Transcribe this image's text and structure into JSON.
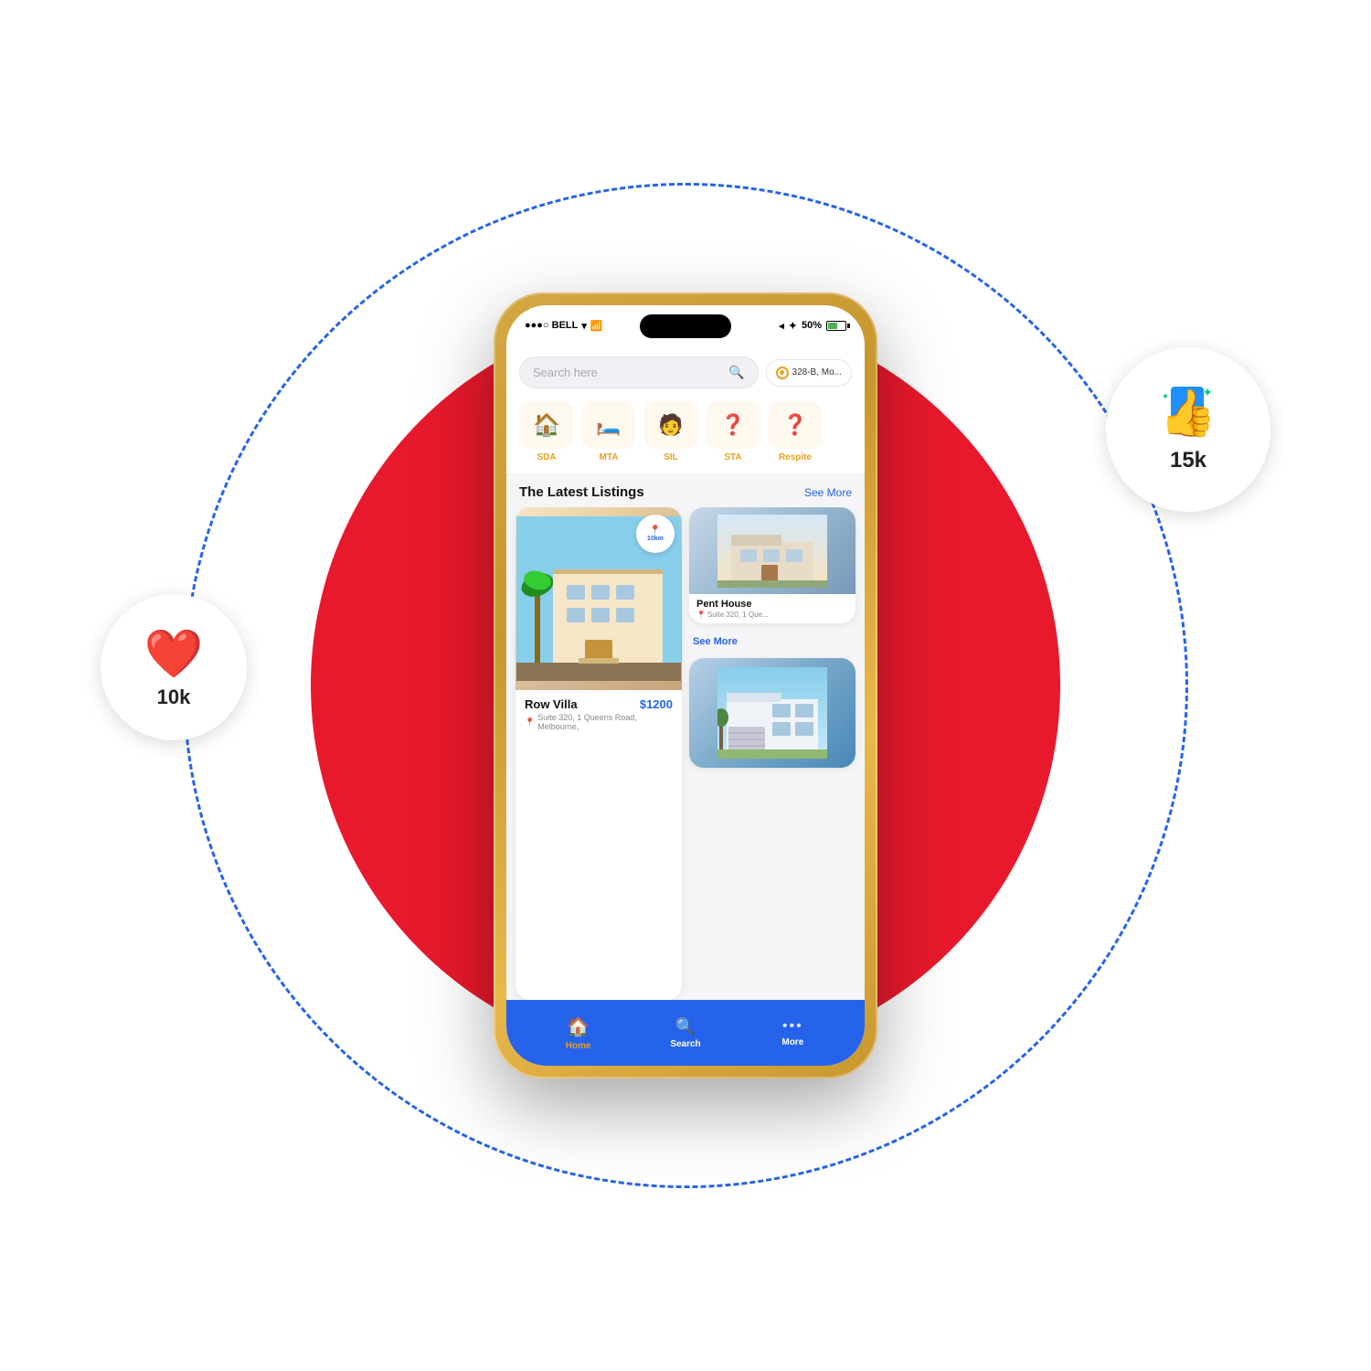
{
  "scene": {
    "background": "#ffffff"
  },
  "badges": {
    "likes": {
      "count": "10k",
      "icon": "❤️"
    },
    "thumbs": {
      "count": "15k",
      "emoji": "👍"
    }
  },
  "phone": {
    "statusBar": {
      "carrier": "●●●○ BELL",
      "wifi": "wifi",
      "time": "",
      "battery": "50%"
    },
    "searchBar": {
      "placeholder": "Search here",
      "locationLabel": "328-B, Mo..."
    },
    "categories": [
      {
        "label": "SDA",
        "icon": "🏠"
      },
      {
        "label": "MTA",
        "icon": "🛏"
      },
      {
        "label": "SIL",
        "icon": "👤"
      },
      {
        "label": "STA",
        "icon": "❓"
      },
      {
        "label": "Respite",
        "icon": "❓"
      }
    ],
    "listingsSection": {
      "title": "The Latest Listings",
      "seeMoreLabel": "See More"
    },
    "listings": [
      {
        "id": "row-villa",
        "name": "Row Villa",
        "price": "$1200",
        "address": "Suite 320, 1 Queens Road, Melbourne,",
        "distance": "10km",
        "size": "large"
      },
      {
        "id": "pent-house",
        "name": "Pent House",
        "address": "Suite 320, 1 Que...",
        "size": "small-top"
      },
      {
        "id": "see-more",
        "label": "See More",
        "size": "link"
      },
      {
        "id": "house-3",
        "name": "",
        "size": "small-bottom"
      }
    ],
    "bottomNav": [
      {
        "id": "home",
        "label": "Home",
        "icon": "🏠",
        "active": true
      },
      {
        "id": "search",
        "label": "Search",
        "icon": "🔍",
        "active": false
      },
      {
        "id": "more",
        "label": "More",
        "icon": "•••",
        "active": false
      }
    ]
  }
}
